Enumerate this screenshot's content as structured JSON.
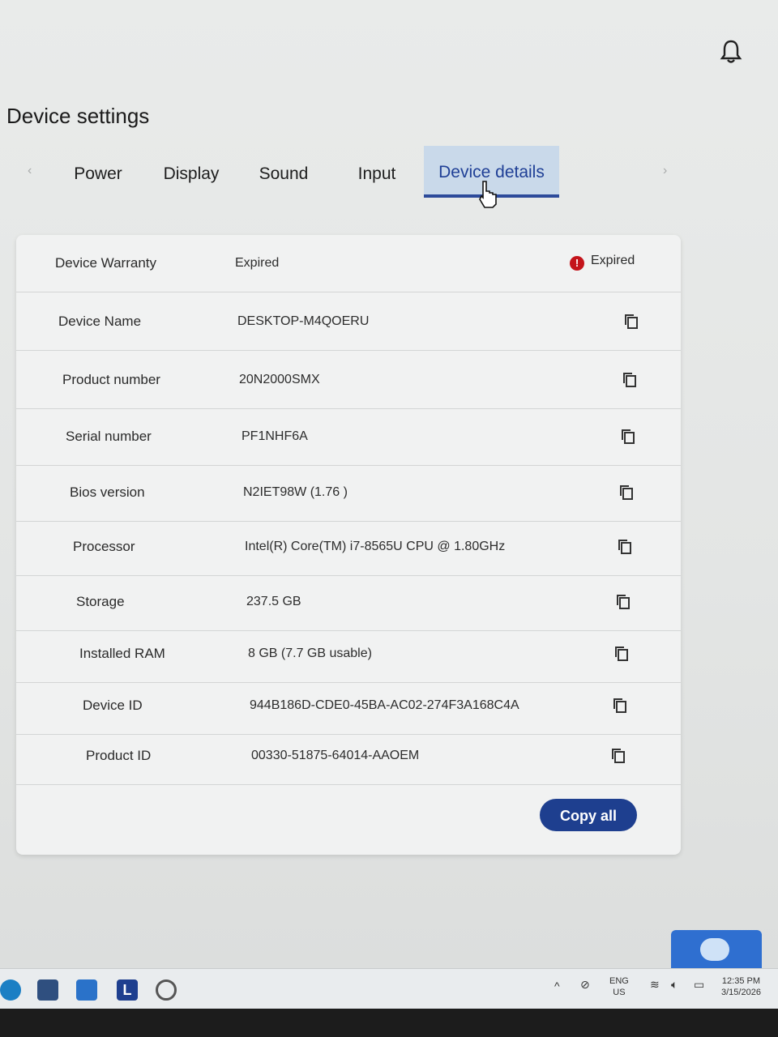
{
  "page": {
    "title": "Device settings"
  },
  "tabs": {
    "prev": "‹",
    "next": "›",
    "items": [
      {
        "label": "Power"
      },
      {
        "label": "Display"
      },
      {
        "label": "Sound"
      },
      {
        "label": "Input"
      },
      {
        "label": "Device details",
        "active": true
      }
    ]
  },
  "details": {
    "rows": [
      {
        "label": "Device Warranty",
        "value": "Expired",
        "badge": "Expired",
        "badge_icon": "!"
      },
      {
        "label": "Device Name",
        "value": "DESKTOP-M4QOERU"
      },
      {
        "label": "Product number",
        "value": "20N2000SMX"
      },
      {
        "label": "Serial number",
        "value": "PF1NHF6A"
      },
      {
        "label": "Bios version",
        "value": "N2IET98W (1.76 )"
      },
      {
        "label": "Processor",
        "value": "Intel(R) Core(TM) i7-8565U CPU @ 1.80GHz"
      },
      {
        "label": "Storage",
        "value": "237.5 GB"
      },
      {
        "label": "Installed RAM",
        "value": "8 GB (7.7 GB usable)"
      },
      {
        "label": "Device ID",
        "value": "944B186D-CDE0-45BA-AC02-274F3A168C4A"
      },
      {
        "label": "Product ID",
        "value": "00330-51875-64014-AAOEM"
      }
    ],
    "copy_all_label": "Copy all"
  },
  "taskbar": {
    "start_letter": "L",
    "language": "ENG",
    "region": "US",
    "time": "12:35 PM",
    "date": "3/15/2026"
  },
  "colors": {
    "accent": "#1e3f8f",
    "tab_active_bg": "#c9d9ea",
    "error": "#c4141b"
  }
}
